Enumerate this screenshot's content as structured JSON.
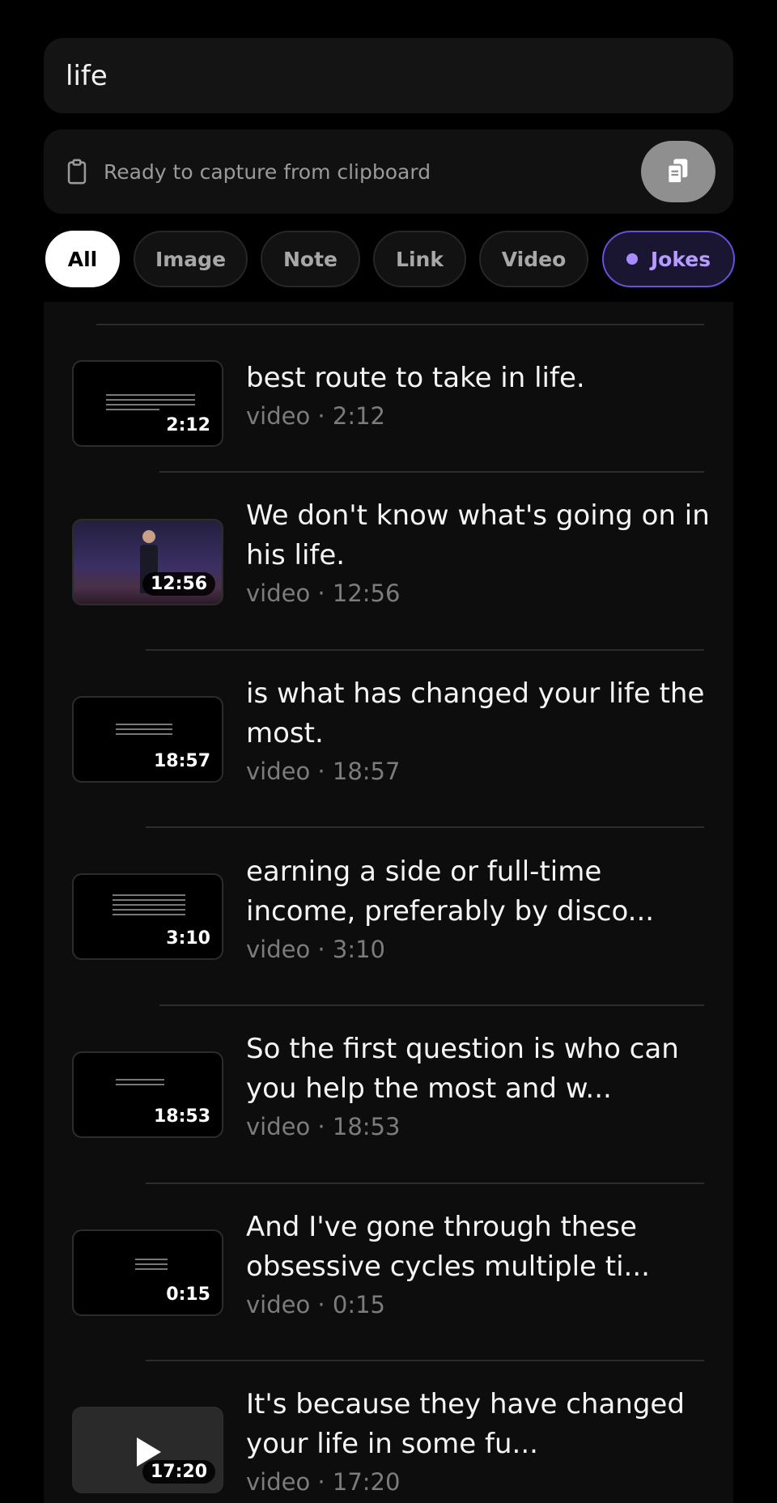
{
  "search": {
    "query": "life"
  },
  "clipboard": {
    "status_text": "Ready to capture from clipboard",
    "button_icon": "paste-icon",
    "status_icon": "clipboard-icon"
  },
  "filters": [
    {
      "label": "All",
      "active": true
    },
    {
      "label": "Image",
      "active": false
    },
    {
      "label": "Note",
      "active": false
    },
    {
      "label": "Link",
      "active": false
    },
    {
      "label": "Video",
      "active": false
    },
    {
      "label": "Jokes",
      "active": false,
      "accent": "#a98bff"
    }
  ],
  "results": [
    {
      "title": "best route to take in life.",
      "meta": "video · 2:12",
      "duration": "2:12"
    },
    {
      "title": "We don't know what's going on in his life.",
      "meta": "video · 12:56",
      "duration": "12:56"
    },
    {
      "title": "is what has changed your life the most.",
      "meta": "video · 18:57",
      "duration": "18:57"
    },
    {
      "title": "earning a side or full-time income, preferably by disco...",
      "meta": "video · 3:10",
      "duration": "3:10"
    },
    {
      "title": "So the first question is who can you help the most and w...",
      "meta": "video · 18:53",
      "duration": "18:53"
    },
    {
      "title": "And I've gone through these obsessive cycles multiple ti...",
      "meta": "video · 0:15",
      "duration": "0:15"
    },
    {
      "title": "It's because they have changed your life in some fu...",
      "meta": "video · 17:20",
      "duration": "17:20"
    }
  ]
}
